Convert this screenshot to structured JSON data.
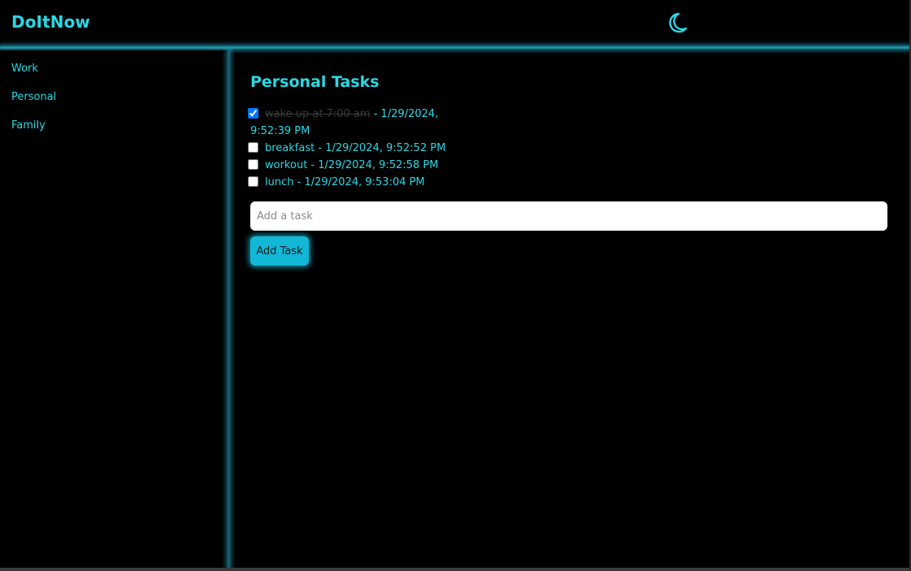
{
  "app": {
    "title": "DoItNow",
    "theme_icon": "moon-icon",
    "accent_color": "#2ad8e4",
    "button_color": "#12b8d6"
  },
  "sidebar": {
    "items": [
      {
        "label": "Work"
      },
      {
        "label": "Personal"
      },
      {
        "label": "Family"
      }
    ]
  },
  "main": {
    "section_title": "Personal Tasks",
    "tasks": [
      {
        "name": "wake up at 7:00 am",
        "separator": " - ",
        "timestamp": "1/29/2024, 9:52:39 PM",
        "completed": true
      },
      {
        "name": "breakfast",
        "separator": " - ",
        "timestamp": "1/29/2024, 9:52:52 PM",
        "completed": false
      },
      {
        "name": "workout",
        "separator": " - ",
        "timestamp": "1/29/2024, 9:52:58 PM",
        "completed": false
      },
      {
        "name": "lunch",
        "separator": " - ",
        "timestamp": "1/29/2024, 9:53:04 PM",
        "completed": false
      }
    ],
    "input": {
      "placeholder": "Add a task",
      "value": ""
    },
    "add_button_label": "Add Task"
  }
}
